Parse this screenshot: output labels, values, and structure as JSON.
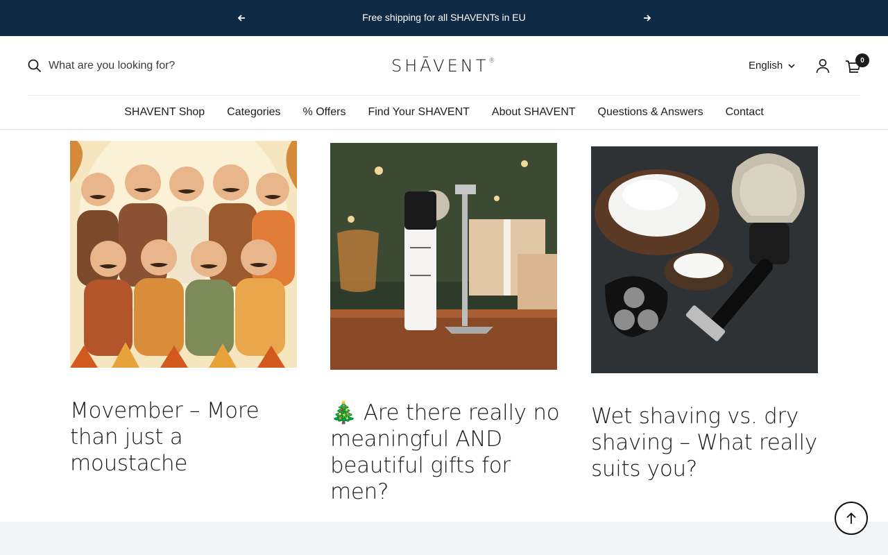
{
  "announcement": {
    "text": "Free shipping for all SHAVENTs in EU",
    "prev_icon": "arrow-left-icon",
    "next_icon": "arrow-right-icon"
  },
  "header": {
    "search_placeholder": "What are you looking for?",
    "logo": "SHĀVENT",
    "logo_mark": "®",
    "language": "English",
    "cart_count": "0"
  },
  "nav": {
    "items": [
      {
        "label": "SHAVENT Shop"
      },
      {
        "label": "Categories"
      },
      {
        "label": "% Offers"
      },
      {
        "label": "Find Your SHAVENT"
      },
      {
        "label": "About SHAVENT"
      },
      {
        "label": "Questions & Answers"
      },
      {
        "label": "Contact"
      }
    ]
  },
  "articles": [
    {
      "title": "Movember – More than just a moustache",
      "image": "illustration of group of moustached men"
    },
    {
      "title": "🎄 Are there really no meaningful AND beautiful gifts for men?",
      "image": "calm balm bottle and safety razor with gifts"
    },
    {
      "title": "Wet shaving vs. dry shaving – What really suits you?",
      "image": "shaving brush, foam bowl, razor and electric shaver"
    }
  ],
  "colors": {
    "announcement_bg": "#0f2a44",
    "footer_bg": "#f3f4f6"
  }
}
